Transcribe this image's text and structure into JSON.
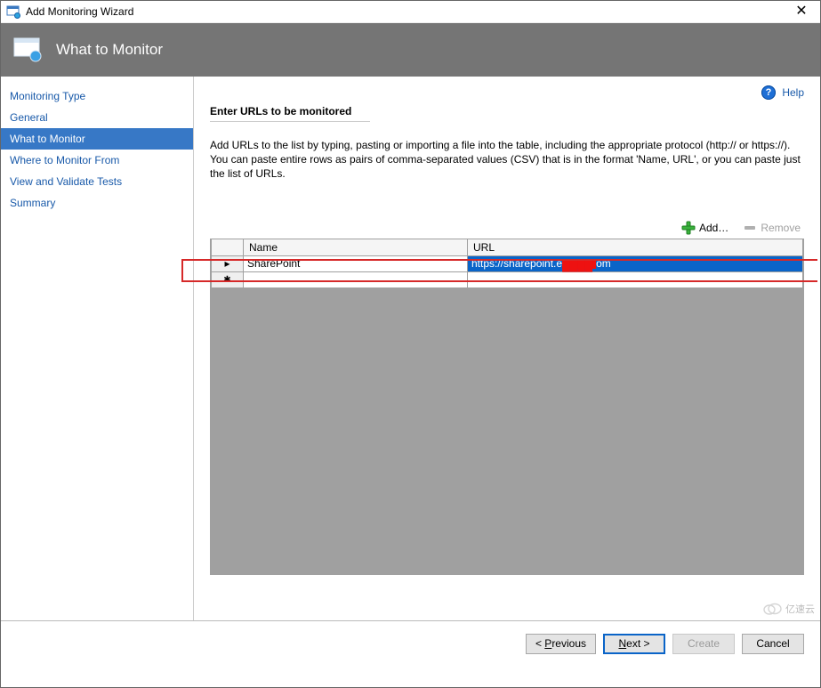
{
  "titlebar": {
    "title": "Add Monitoring Wizard"
  },
  "header": {
    "title": "What to Monitor"
  },
  "sidebar": {
    "items": [
      {
        "label": "Monitoring Type"
      },
      {
        "label": "General"
      },
      {
        "label": "What to Monitor"
      },
      {
        "label": "Where to Monitor From"
      },
      {
        "label": "View and Validate Tests"
      },
      {
        "label": "Summary"
      }
    ],
    "active_index": 2
  },
  "help": {
    "label": "Help"
  },
  "section": {
    "title": "Enter URLs to be monitored",
    "desc": "Add URLs to the list by typing, pasting or importing a file into the table, including the appropriate protocol (http:// or https://). You can paste entire rows as pairs of comma-separated values (CSV) that is in the format 'Name, URL', or you can paste just the list of URLs."
  },
  "toolbar": {
    "add_label": "Add…",
    "remove_label": "Remove"
  },
  "grid": {
    "columns": {
      "name": "Name",
      "url": "URL"
    },
    "rows": [
      {
        "name": "SharePoint",
        "url_prefix": "https://sharepoint.e",
        "url_suffix": "om"
      }
    ]
  },
  "footer": {
    "previous": "Previous",
    "next": "Next >",
    "create": "Create",
    "cancel": "Cancel"
  },
  "watermark": "亿速云"
}
